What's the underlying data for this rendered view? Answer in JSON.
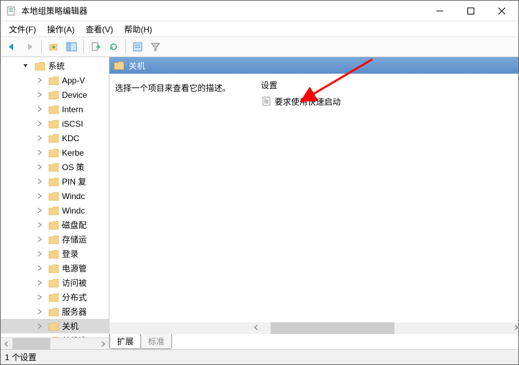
{
  "title": "本地组策略编辑器",
  "menu": {
    "file": "文件(F)",
    "action": "操作(A)",
    "view": "查看(V)",
    "help": "帮助(H)"
  },
  "tree": {
    "root": "系统",
    "items": [
      "App-V",
      "Device",
      "Intern",
      "iSCSI",
      "KDC",
      "Kerbe",
      "OS 策",
      "PIN 复",
      "Windc",
      "Windc",
      "磁盘配",
      "存储运",
      "登录",
      "电源管",
      "访问被",
      "分布式",
      "服务器",
      "关机",
      "关机选"
    ]
  },
  "detail": {
    "header": "关机",
    "description": "选择一个项目来查看它的描述。",
    "settings_label": "设置",
    "setting_item": "要求使用快速启动"
  },
  "tabs": {
    "extended": "扩展",
    "standard": "标准"
  },
  "status": "1 个设置"
}
